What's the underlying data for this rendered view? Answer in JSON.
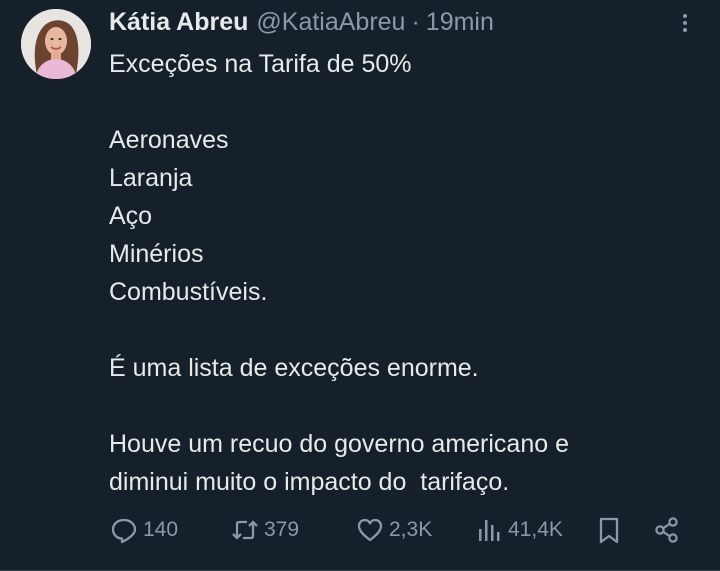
{
  "author": {
    "name": "Kátia Abreu",
    "handle": "@KatiaAbreu",
    "separator": "·",
    "time": "19min"
  },
  "tweet": {
    "lines": [
      "Exceções na Tarifa de 50%",
      "",
      "Aeronaves",
      "Laranja",
      "Aço",
      "Minérios",
      "Combustíveis.",
      "",
      "É uma lista de exceções enorme.",
      "",
      "Houve um recuo do governo americano e",
      "diminui muito o impacto do  tarifaço."
    ]
  },
  "actions": {
    "replies": "140",
    "retweets": "379",
    "likes": "2,3K",
    "views": "41,4K"
  },
  "colors": {
    "background": "#15202b",
    "text": "#e7e9ea",
    "secondary": "#8b98a5"
  },
  "icons": {
    "more": "more-vertical-icon",
    "reply": "reply-icon",
    "retweet": "retweet-icon",
    "like": "heart-icon",
    "views": "views-icon",
    "bookmark": "bookmark-icon",
    "share": "share-icon"
  }
}
